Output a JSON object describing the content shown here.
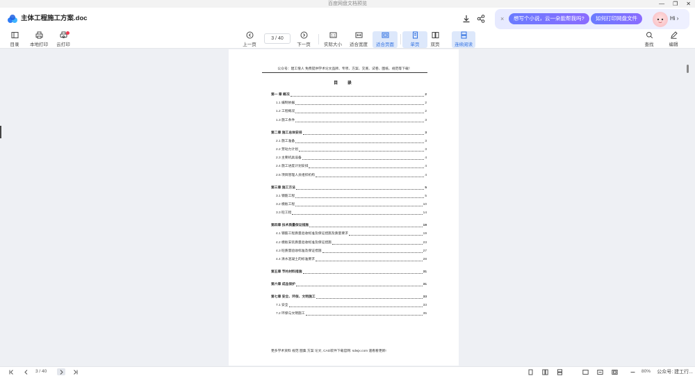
{
  "window": {
    "title": "百度网盘文档预览",
    "controls": [
      "—",
      "❐",
      "✕"
    ]
  },
  "doc": {
    "title": "主体工程施工方案.doc"
  },
  "assistant": {
    "close": "×",
    "prompt1": "想写个小说，云一朵能帮我吗?",
    "prompt2": "如何打印网盘文件",
    "greeting": "Hi ›"
  },
  "toolbar": {
    "outline": "目录",
    "local_print": "本地打印",
    "cloud_print": "云打印",
    "prev": "上一页",
    "page_indicator": "3 / 40",
    "next": "下一页",
    "actual_size": "实际大小",
    "fit_width": "适合宽度",
    "fit_page": "适合页面",
    "single": "单页",
    "double": "双页",
    "continuous": "连续阅读",
    "find": "查找",
    "edit": "编辑"
  },
  "page": {
    "header": "公众号：建工僧人 免费提供学术论文品牌、专项、方案、交底、试卷、图纸、规范等下载！",
    "toc_title": "目 录",
    "footer": "更多学术资料 规范 图集 方案 论文, CAD软件下载官网: sdwjx.com 速看看更新!",
    "toc": [
      {
        "text": "第一 章  概况",
        "page": "2",
        "chapter": true
      },
      {
        "text": "1.1 编制依据",
        "page": "2",
        "chapter": false
      },
      {
        "text": "1.2 工程概况",
        "page": "2",
        "chapter": false
      },
      {
        "text": "1.3 施工条件",
        "page": "3",
        "chapter": false
      },
      {
        "text": "第二章  施工总体安排",
        "page": "3",
        "chapter": true
      },
      {
        "text": "2.1 施工准备",
        "page": "3",
        "chapter": false
      },
      {
        "text": "2.2 劳动力计划",
        "page": "3",
        "chapter": false
      },
      {
        "text": "2.3 主要机具设备",
        "page": "4",
        "chapter": false
      },
      {
        "text": "2.4 施工进度计划安排",
        "page": "4",
        "chapter": false
      },
      {
        "text": "2.5 项目管理人员组织机构",
        "page": "4",
        "chapter": false
      },
      {
        "text": "第三章    施工方法",
        "page": "5",
        "chapter": true
      },
      {
        "text": "3.1 钢筋工程",
        "page": "5",
        "chapter": false
      },
      {
        "text": "3.2 模板工程",
        "page": "10",
        "chapter": false
      },
      {
        "text": "3.3 砼工程",
        "page": "14",
        "chapter": false
      },
      {
        "text": "第四章  技术质量保证措施",
        "page": "19",
        "chapter": true
      },
      {
        "text": "4.1 钢筋工程质量验收标准及保证措施及质量要求",
        "page": "19",
        "chapter": false
      },
      {
        "text": "4.2 模板安装质量验收标准及保证措施",
        "page": "23",
        "chapter": false
      },
      {
        "text": "4.3 砼质量验收标准及保证措施",
        "page": "27",
        "chapter": false
      },
      {
        "text": "4.4 清水混凝土的标准要求",
        "page": "28",
        "chapter": false
      },
      {
        "text": "第五章  节约材料措施",
        "page": "31",
        "chapter": true
      },
      {
        "text": "第六章  成品保护",
        "page": "31",
        "chapter": true
      },
      {
        "text": "第七章  安全、环保、文明施工",
        "page": "33",
        "chapter": true
      },
      {
        "text": "7.1 安全",
        "page": "33",
        "chapter": false
      },
      {
        "text": "7.2 环保与文明施工",
        "page": "35",
        "chapter": false
      }
    ]
  },
  "statusbar": {
    "page_indicator": "3 / 40",
    "zoom": "80%",
    "watermark": "公众号: 建工行..."
  }
}
